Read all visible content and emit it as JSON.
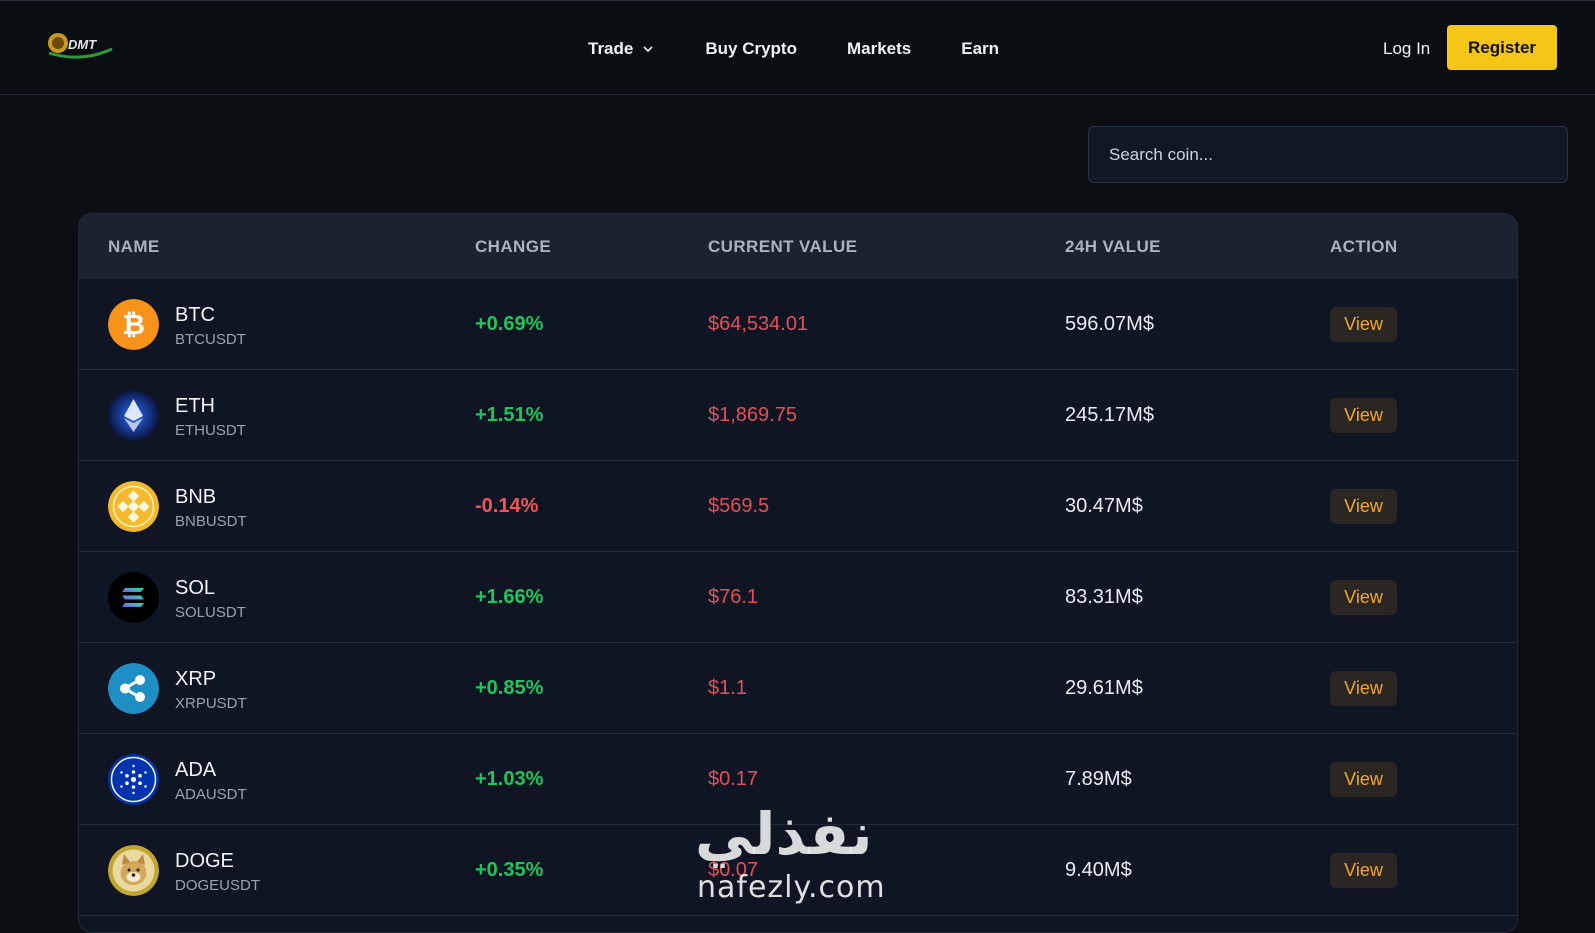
{
  "brand": {
    "logo_text": "DMT"
  },
  "nav": {
    "items": [
      {
        "label": "Trade",
        "has_dropdown": true
      },
      {
        "label": "Buy Crypto"
      },
      {
        "label": "Markets"
      },
      {
        "label": "Earn"
      }
    ]
  },
  "auth": {
    "login_label": "Log In",
    "register_label": "Register"
  },
  "search": {
    "placeholder": "Search coin..."
  },
  "table": {
    "headers": [
      "NAME",
      "CHANGE",
      "CURRENT VALUE",
      "24H VALUE",
      "ACTION"
    ],
    "rows": [
      {
        "symbol": "BTC",
        "pair": "BTCUSDT",
        "change": "+0.69%",
        "direction": "up",
        "current": "$64,534.01",
        "volume": "596.07M$",
        "action": "View",
        "icon": "bitcoin-icon"
      },
      {
        "symbol": "ETH",
        "pair": "ETHUSDT",
        "change": "+1.51%",
        "direction": "up",
        "current": "$1,869.75",
        "volume": "245.17M$",
        "action": "View",
        "icon": "ethereum-icon"
      },
      {
        "symbol": "BNB",
        "pair": "BNBUSDT",
        "change": "-0.14%",
        "direction": "down",
        "current": "$569.5",
        "volume": "30.47M$",
        "action": "View",
        "icon": "bnb-icon"
      },
      {
        "symbol": "SOL",
        "pair": "SOLUSDT",
        "change": "+1.66%",
        "direction": "up",
        "current": "$76.1",
        "volume": "83.31M$",
        "action": "View",
        "icon": "solana-icon"
      },
      {
        "symbol": "XRP",
        "pair": "XRPUSDT",
        "change": "+0.85%",
        "direction": "up",
        "current": "$1.1",
        "volume": "29.61M$",
        "action": "View",
        "icon": "xrp-icon"
      },
      {
        "symbol": "ADA",
        "pair": "ADAUSDT",
        "change": "+1.03%",
        "direction": "up",
        "current": "$0.17",
        "volume": "7.89M$",
        "action": "View",
        "icon": "cardano-icon"
      },
      {
        "symbol": "DOGE",
        "pair": "DOGEUSDT",
        "change": "+0.35%",
        "direction": "up",
        "current": "$0.07",
        "volume": "9.40M$",
        "action": "View",
        "icon": "dogecoin-icon"
      }
    ]
  },
  "watermark": {
    "arabic": "نفذلي",
    "latin": "nafezly.com"
  },
  "colors": {
    "background": "#0b0e13",
    "accent": "#f5c518",
    "positive": "#21c45d",
    "negative": "#f0555c",
    "view_text": "#f5a623"
  }
}
